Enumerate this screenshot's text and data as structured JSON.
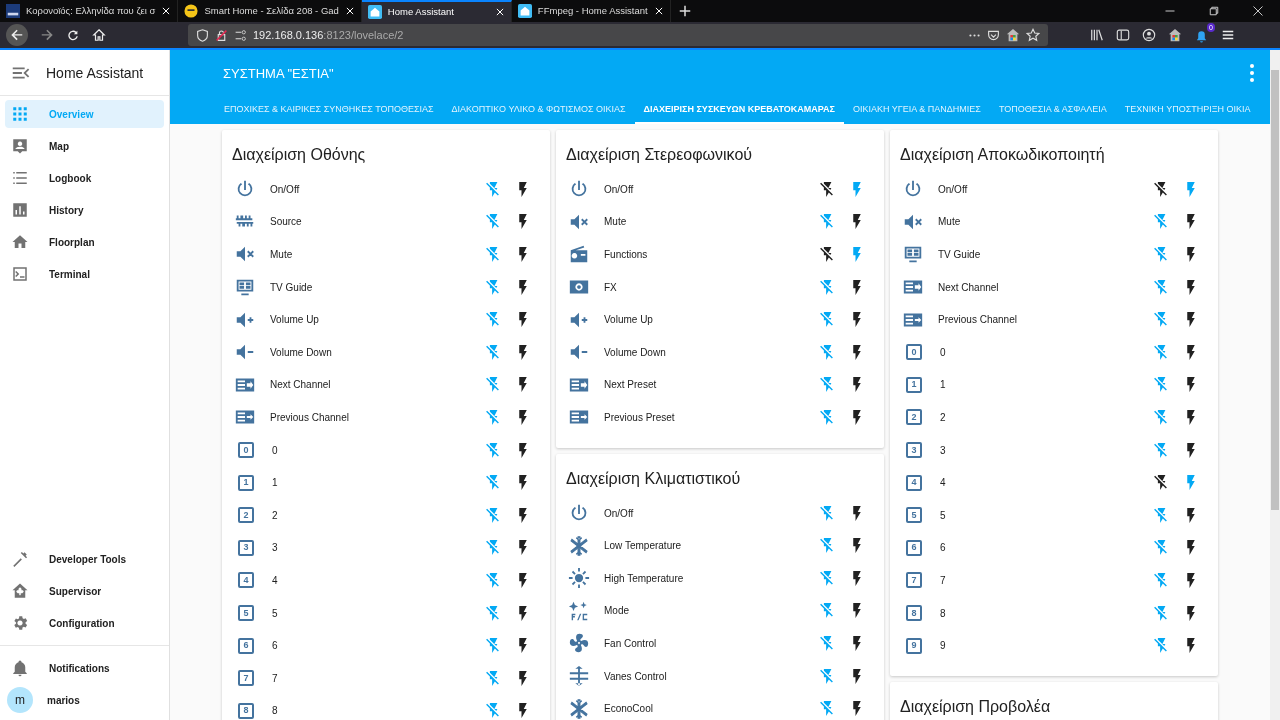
{
  "browser": {
    "tabs": [
      {
        "title": "Κορονοϊός: Ελληνίδα που ζει σ",
        "kind": "news",
        "selected": false
      },
      {
        "title": "Smart Home - Σελίδα 208 - Gad",
        "kind": "forum",
        "selected": false
      },
      {
        "title": "Home Assistant",
        "kind": "ha",
        "selected": true
      },
      {
        "title": "FFmpeg - Home Assistant",
        "kind": "ha",
        "selected": false
      }
    ],
    "url_host": "192.168.0.136",
    "url_rest": ":8123/lovelace/2",
    "notification_count": "0"
  },
  "sidebar": {
    "title": "Home Assistant",
    "items": [
      {
        "label": "Overview",
        "kind": "grid",
        "selected": true
      },
      {
        "label": "Map",
        "kind": "map",
        "selected": false
      },
      {
        "label": "Logbook",
        "kind": "list",
        "selected": false
      },
      {
        "label": "History",
        "kind": "chart",
        "selected": false
      },
      {
        "label": "Floorplan",
        "kind": "home",
        "selected": false
      },
      {
        "label": "Terminal",
        "kind": "terminal",
        "selected": false
      }
    ],
    "bottom_items": [
      {
        "label": "Developer Tools",
        "kind": "hammer",
        "selected": false
      },
      {
        "label": "Supervisor",
        "kind": "supervisor",
        "selected": false
      },
      {
        "label": "Configuration",
        "kind": "gear",
        "selected": false
      }
    ],
    "notifications": "Notifications",
    "user": {
      "initial": "m",
      "name": "marios"
    }
  },
  "header": {
    "title": "ΣΥΣΤΗΜΑ \"ΕΣΤΙΑ\"",
    "tabs": [
      {
        "label": "ΕΠΟΧΙΚΕΣ & ΚΑΙΡΙΚΕΣ ΣΥΝΘΗΚΕΣ ΤΟΠΟΘΕΣΙΑΣ",
        "selected": false
      },
      {
        "label": "ΔΙΑΚΟΠΤΙΚΟ ΥΛΙΚΟ & ΦΩΤΙΣΜΟΣ ΟΙΚΙΑΣ",
        "selected": false
      },
      {
        "label": "ΔΙΑΧΕΙΡΙΣΗ ΣΥΣΚΕΥΩΝ ΚΡΕΒΑΤΟΚΑΜΑΡΑΣ",
        "selected": true
      },
      {
        "label": "ΟΙΚΙΑΚΗ ΥΓΕΙΑ & ΠΑΝΔΗΜΙΕΣ",
        "selected": false
      },
      {
        "label": "ΤΟΠΟΘΕΣΙΑ & ΑΣΦΑΛΕΙΑ",
        "selected": false
      },
      {
        "label": "ΤΕΧΝΙΚΗ ΥΠΟΣΤΗΡΙΞΗ ΟΙΚΙΑ",
        "selected": false
      }
    ]
  },
  "columns": [
    {
      "cards": [
        {
          "title": "Διαχείριση Οθόνης",
          "rows": [
            {
              "label": "On/Off",
              "kind": "power",
              "on": false
            },
            {
              "label": "Source",
              "kind": "source",
              "on": false
            },
            {
              "label": "Mute",
              "kind": "mute",
              "on": false
            },
            {
              "label": "TV Guide",
              "kind": "guide",
              "on": false
            },
            {
              "label": "Volume Up",
              "kind": "volup",
              "on": false
            },
            {
              "label": "Volume Down",
              "kind": "voldown",
              "on": false
            },
            {
              "label": "Next Channel",
              "kind": "next",
              "on": false
            },
            {
              "label": "Previous Channel",
              "kind": "prev",
              "on": false
            },
            {
              "label": "0",
              "kind": "digit",
              "digit": "0",
              "on": false
            },
            {
              "label": "1",
              "kind": "digit",
              "digit": "1",
              "on": false
            },
            {
              "label": "2",
              "kind": "digit",
              "digit": "2",
              "on": false
            },
            {
              "label": "3",
              "kind": "digit",
              "digit": "3",
              "on": false
            },
            {
              "label": "4",
              "kind": "digit",
              "digit": "4",
              "on": false
            },
            {
              "label": "5",
              "kind": "digit",
              "digit": "5",
              "on": false
            },
            {
              "label": "6",
              "kind": "digit",
              "digit": "6",
              "on": false
            },
            {
              "label": "7",
              "kind": "digit",
              "digit": "7",
              "on": false
            },
            {
              "label": "8",
              "kind": "digit",
              "digit": "8",
              "on": false
            }
          ]
        }
      ]
    },
    {
      "cards": [
        {
          "title": "Διαχείριση Στερεοφωνικού",
          "rows": [
            {
              "label": "On/Off",
              "kind": "power",
              "on": true
            },
            {
              "label": "Mute",
              "kind": "mute",
              "on": false
            },
            {
              "label": "Functions",
              "kind": "radio",
              "on": true
            },
            {
              "label": "FX",
              "kind": "fx",
              "on": false
            },
            {
              "label": "Volume Up",
              "kind": "volup",
              "on": false
            },
            {
              "label": "Volume Down",
              "kind": "voldown",
              "on": false
            },
            {
              "label": "Next Preset",
              "kind": "next",
              "on": false
            },
            {
              "label": "Previous Preset",
              "kind": "prev",
              "on": false
            }
          ]
        },
        {
          "title": "Διαχείριση Κλιματιστικού",
          "rows": [
            {
              "label": "On/Off",
              "kind": "power",
              "on": false
            },
            {
              "label": "Low Temperature",
              "kind": "snow",
              "on": false
            },
            {
              "label": "High Temperature",
              "kind": "sun",
              "on": false
            },
            {
              "label": "Mode",
              "kind": "mode",
              "on": false
            },
            {
              "label": "Fan Control",
              "kind": "fan",
              "on": false
            },
            {
              "label": "Vanes Control",
              "kind": "vanes",
              "on": false
            },
            {
              "label": "EconoCool",
              "kind": "snow",
              "on": false
            }
          ]
        }
      ]
    },
    {
      "cards": [
        {
          "title": "Διαχείριση Αποκωδικοποιητή",
          "rows": [
            {
              "label": "On/Off",
              "kind": "power",
              "on": true
            },
            {
              "label": "Mute",
              "kind": "mute",
              "on": false
            },
            {
              "label": "TV Guide",
              "kind": "guide",
              "on": false
            },
            {
              "label": "Next Channel",
              "kind": "next",
              "on": false
            },
            {
              "label": "Previous Channel",
              "kind": "prev",
              "on": false
            },
            {
              "label": "0",
              "kind": "digit",
              "digit": "0",
              "on": false
            },
            {
              "label": "1",
              "kind": "digit",
              "digit": "1",
              "on": false
            },
            {
              "label": "2",
              "kind": "digit",
              "digit": "2",
              "on": false
            },
            {
              "label": "3",
              "kind": "digit",
              "digit": "3",
              "on": false
            },
            {
              "label": "4",
              "kind": "digit",
              "digit": "4",
              "on": true
            },
            {
              "label": "5",
              "kind": "digit",
              "digit": "5",
              "on": false
            },
            {
              "label": "6",
              "kind": "digit",
              "digit": "6",
              "on": false
            },
            {
              "label": "7",
              "kind": "digit",
              "digit": "7",
              "on": false
            },
            {
              "label": "8",
              "kind": "digit",
              "digit": "8",
              "on": false
            },
            {
              "label": "9",
              "kind": "digit",
              "digit": "9",
              "on": false
            }
          ]
        },
        {
          "title": "Διαχείριση Προβολέα"
        }
      ]
    }
  ]
}
